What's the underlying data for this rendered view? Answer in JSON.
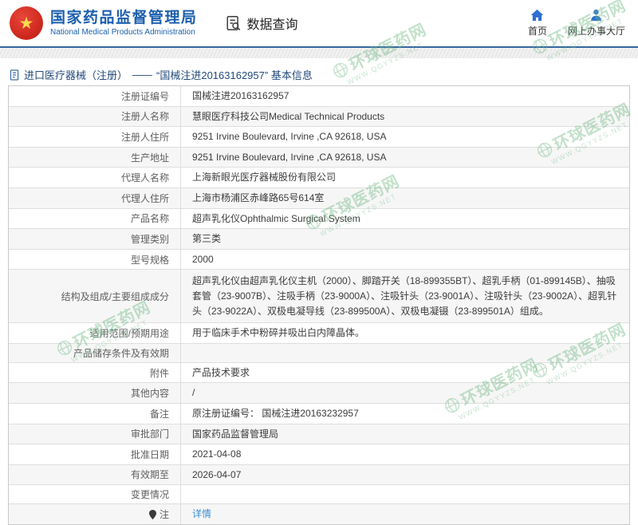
{
  "header": {
    "title": "国家药品监督管理局",
    "subtitle": "National Medical Products Administration",
    "query_label": "数据查询",
    "links": {
      "home": "首页",
      "hall": "网上办事大厅"
    }
  },
  "breadcrumb": {
    "section": "进口医疗器械（注册）",
    "separator": "——",
    "current": "“国械注进20163162957” 基本信息"
  },
  "table": {
    "rows": [
      {
        "label": "注册证编号",
        "value": "国械注进20163162957"
      },
      {
        "label": "注册人名称",
        "value": "慧眼医疗科技公司Medical Technical Products"
      },
      {
        "label": "注册人住所",
        "value": "9251 Irvine Boulevard, Irvine ,CA 92618, USA"
      },
      {
        "label": "生产地址",
        "value": "9251 Irvine Boulevard, Irvine ,CA 92618, USA"
      },
      {
        "label": "代理人名称",
        "value": "上海新眼光医疗器械股份有限公司"
      },
      {
        "label": "代理人住所",
        "value": "上海市杨浦区赤峰路65号614室"
      },
      {
        "label": "产品名称",
        "value": "超声乳化仪Ophthalmic Surgical System"
      },
      {
        "label": "管理类别",
        "value": "第三类"
      },
      {
        "label": "型号规格",
        "value": "2000"
      },
      {
        "label": "结构及组成/主要组成成分",
        "value": "超声乳化仪由超声乳化仪主机（2000）、脚踏开关（18-899355BT）、超乳手柄（01-899145B）、抽吸套管（23-9007B）、注吸手柄（23-9000A）、注吸针头（23-9001A）、注吸针头（23-9002A）、超乳针头（23-9022A）、双极电凝导线（23-899500A）、双极电凝镊（23-899501A）组成。",
        "tall": true
      },
      {
        "label": "适用范围/预期用途",
        "value": "用于临床手术中粉碎并吸出白内障晶体。"
      },
      {
        "label": "产品储存条件及有效期",
        "value": ""
      },
      {
        "label": "附件",
        "value": "产品技术要求"
      },
      {
        "label": "其他内容",
        "value": "/"
      },
      {
        "label": "备注",
        "value": "原注册证编号： 国械注进20163232957"
      },
      {
        "label": "审批部门",
        "value": "国家药品监督管理局"
      },
      {
        "label": "批准日期",
        "value": "2021-04-08"
      },
      {
        "label": "有效期至",
        "value": "2026-04-07"
      },
      {
        "label": "变更情况",
        "value": ""
      },
      {
        "label": "注",
        "value": "详情",
        "link": true,
        "icon": "pin"
      }
    ]
  },
  "watermark": {
    "name": "环球医药网",
    "url": "WWW.QGYYZS.NET"
  },
  "colors": {
    "accent_blue": "#1c5fae",
    "header_line": "#33679e",
    "link_blue": "#3d8fd4",
    "icon_blue": "#2e6fd0",
    "watermark_green": "#6fb883",
    "emblem_red": "#cb261b",
    "emblem_yellow": "#ffd84d"
  }
}
